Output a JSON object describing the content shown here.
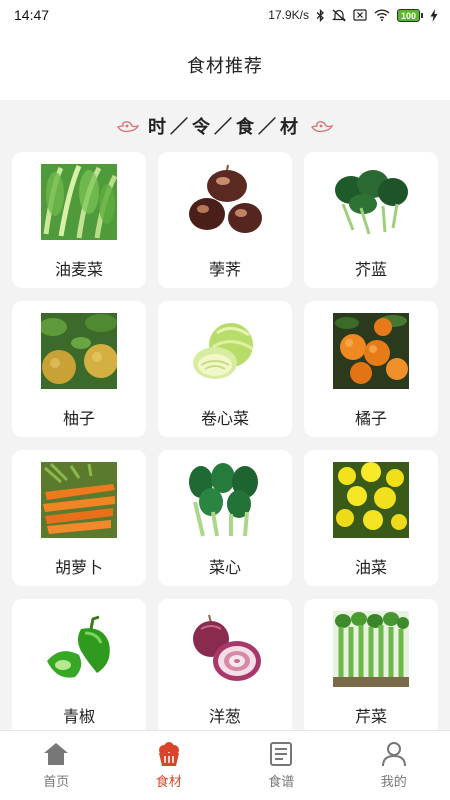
{
  "status_bar": {
    "time": "14:47",
    "speed": "17.9K/s",
    "battery": "100"
  },
  "header": {
    "title": "食材推荐"
  },
  "section": {
    "title": "时／令／食／材"
  },
  "items": [
    {
      "label": "油麦菜",
      "icon": "lettuce-image"
    },
    {
      "label": "荸荠",
      "icon": "water-chestnut-image"
    },
    {
      "label": "芥蓝",
      "icon": "chinese-kale-image"
    },
    {
      "label": "柚子",
      "icon": "pomelo-image"
    },
    {
      "label": "卷心菜",
      "icon": "cabbage-image"
    },
    {
      "label": "橘子",
      "icon": "tangerine-image"
    },
    {
      "label": "胡萝卜",
      "icon": "carrot-image"
    },
    {
      "label": "菜心",
      "icon": "choy-sum-image"
    },
    {
      "label": "油菜",
      "icon": "rapeseed-image"
    },
    {
      "label": "青椒",
      "icon": "green-pepper-image"
    },
    {
      "label": "洋葱",
      "icon": "onion-image"
    },
    {
      "label": "芹菜",
      "icon": "celery-image"
    }
  ],
  "nav": [
    {
      "label": "首页",
      "icon": "home-icon"
    },
    {
      "label": "食材",
      "icon": "food-icon",
      "active": true
    },
    {
      "label": "食谱",
      "icon": "recipe-icon"
    },
    {
      "label": "我的",
      "icon": "profile-icon"
    }
  ],
  "colors": {
    "accent": "#d8452a",
    "background": "#f3f3f3",
    "card": "#ffffff"
  }
}
